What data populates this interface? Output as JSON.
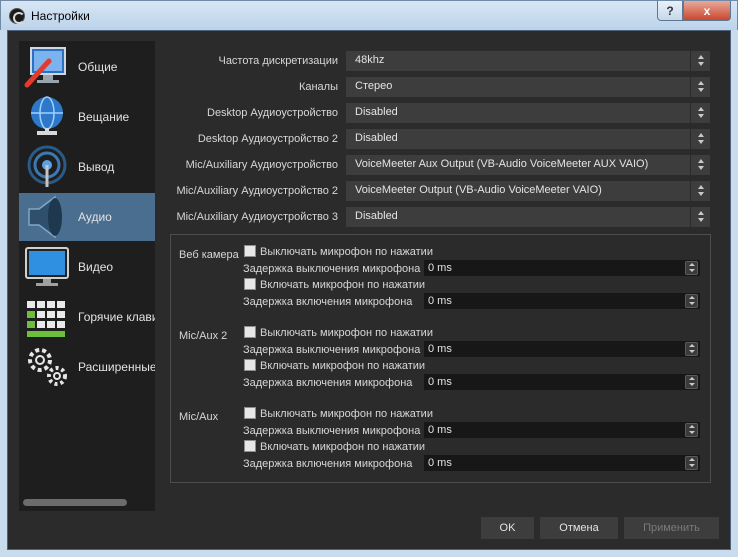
{
  "window": {
    "title": "Настройки",
    "help": "?",
    "close": "x"
  },
  "sidebar": {
    "items": [
      {
        "label": "Общие",
        "icon": "wrench-monitor-icon"
      },
      {
        "label": "Вещание",
        "icon": "globe-network-icon"
      },
      {
        "label": "Вывод",
        "icon": "broadcast-antenna-icon"
      },
      {
        "label": "Аудио",
        "icon": "speaker-icon",
        "active": true
      },
      {
        "label": "Видео",
        "icon": "monitor-icon"
      },
      {
        "label": "Горячие клавиши",
        "icon": "keyboard-icon"
      },
      {
        "label": "Расширенные",
        "icon": "gears-icon"
      }
    ]
  },
  "audio": {
    "sample_rate": {
      "label": "Частота дискретизации",
      "value": "48khz"
    },
    "channels": {
      "label": "Каналы",
      "value": "Стерео"
    },
    "desktop1": {
      "label": "Desktop Аудиоустройство",
      "value": "Disabled"
    },
    "desktop2": {
      "label": "Desktop Аудиоустройство 2",
      "value": "Disabled"
    },
    "mic1": {
      "label": "Mic/Auxiliary Аудиоустройство",
      "value": "VoiceMeeter Aux Output (VB-Audio VoiceMeeter AUX VAIO)"
    },
    "mic2": {
      "label": "Mic/Auxiliary Аудиоустройство 2",
      "value": "VoiceMeeter Output (VB-Audio VoiceMeeter VAIO)"
    },
    "mic3": {
      "label": "Mic/Auxiliary Аудиоустройство 3",
      "value": "Disabled"
    }
  },
  "ptt_groups": [
    {
      "name": "Веб камера",
      "mute_label": "Выключать микрофон по нажатии",
      "mute_delay_label": "Задержка выключения микрофона",
      "mute_delay": "0 ms",
      "talk_label": "Включать микрофон по нажатии",
      "talk_delay_label": "Задержка включения микрофона",
      "talk_delay": "0 ms"
    },
    {
      "name": "Mic/Aux 2",
      "mute_label": "Выключать микрофон по нажатии",
      "mute_delay_label": "Задержка выключения микрофона",
      "mute_delay": "0 ms",
      "talk_label": "Включать микрофон по нажатии",
      "talk_delay_label": "Задержка включения микрофона",
      "talk_delay": "0 ms"
    },
    {
      "name": "Mic/Aux",
      "mute_label": "Выключать микрофон по нажатии",
      "mute_delay_label": "Задержка выключения микрофона",
      "mute_delay": "0 ms",
      "talk_label": "Включать микрофон по нажатии",
      "talk_delay_label": "Задержка включения микрофона",
      "talk_delay": "0 ms"
    }
  ],
  "buttons": {
    "ok": "OK",
    "cancel": "Отмена",
    "apply": "Применить"
  },
  "colors": {
    "active_nav": "#4a6e8f",
    "panel_bg": "#2b2b2b",
    "sidebar_bg": "#1e1e1e"
  }
}
